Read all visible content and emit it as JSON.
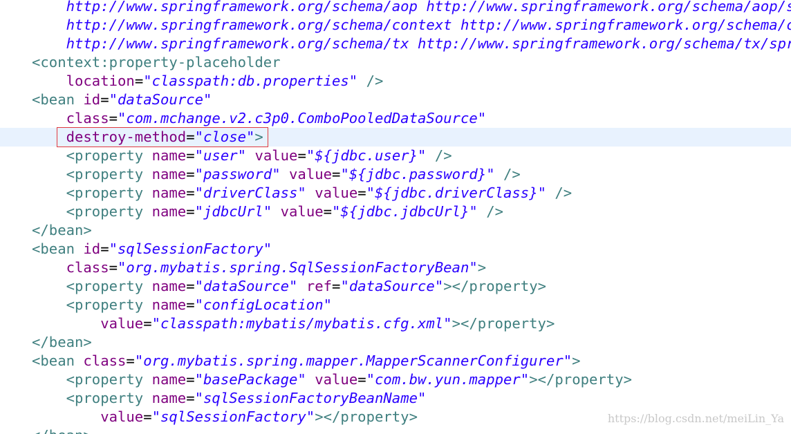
{
  "editor": {
    "lines": [
      {
        "tokens": [
          {
            "t": "    ",
            "c": "plain"
          },
          {
            "t": "http://www.springframework.org/schema/aop http://www.springframework.org/schema/aop/spring-aop.xsd",
            "c": "url"
          }
        ]
      },
      {
        "tokens": [
          {
            "t": "    ",
            "c": "plain"
          },
          {
            "t": "http://www.springframework.org/schema/context http://www.springframework.org/schema/context/spring-context.xsd",
            "c": "url"
          }
        ]
      },
      {
        "tokens": [
          {
            "t": "    ",
            "c": "plain"
          },
          {
            "t": "http://www.springframework.org/schema/tx http://www.springframework.org/schema/tx/spring-tx.xsd",
            "c": "url"
          }
        ]
      },
      {
        "tokens": [
          {
            "t": "<context:property-placeholder",
            "c": "tag"
          }
        ]
      },
      {
        "tokens": [
          {
            "t": "    ",
            "c": "plain"
          },
          {
            "t": "location",
            "c": "attr"
          },
          {
            "t": "=",
            "c": "eq"
          },
          {
            "t": "\"classpath:db.properties\"",
            "c": "val"
          },
          {
            "t": " />",
            "c": "tag"
          }
        ]
      },
      {
        "tokens": [
          {
            "t": "<bean",
            "c": "tag"
          },
          {
            "t": " ",
            "c": "plain"
          },
          {
            "t": "id",
            "c": "attr"
          },
          {
            "t": "=",
            "c": "eq"
          },
          {
            "t": "\"dataSource\"",
            "c": "val"
          }
        ]
      },
      {
        "tokens": [
          {
            "t": "    ",
            "c": "plain"
          },
          {
            "t": "class",
            "c": "attr"
          },
          {
            "t": "=",
            "c": "eq"
          },
          {
            "t": "\"com.mchange.v2.c3p0.ComboPooledDataSource\"",
            "c": "val"
          }
        ]
      },
      {
        "current": true,
        "tokens": [
          {
            "t": "    ",
            "c": "plain"
          },
          {
            "t": "destroy-method",
            "c": "attr"
          },
          {
            "t": "=",
            "c": "eq"
          },
          {
            "t": "\"close\"",
            "c": "val"
          },
          {
            "t": ">",
            "c": "tag"
          }
        ]
      },
      {
        "tokens": [
          {
            "t": "    ",
            "c": "plain"
          },
          {
            "t": "<property",
            "c": "tag"
          },
          {
            "t": " ",
            "c": "plain"
          },
          {
            "t": "name",
            "c": "attr"
          },
          {
            "t": "=",
            "c": "eq"
          },
          {
            "t": "\"user\"",
            "c": "val"
          },
          {
            "t": " ",
            "c": "plain"
          },
          {
            "t": "value",
            "c": "attr"
          },
          {
            "t": "=",
            "c": "eq"
          },
          {
            "t": "\"${jdbc.user}\"",
            "c": "val"
          },
          {
            "t": " />",
            "c": "tag"
          }
        ]
      },
      {
        "tokens": [
          {
            "t": "    ",
            "c": "plain"
          },
          {
            "t": "<property",
            "c": "tag"
          },
          {
            "t": " ",
            "c": "plain"
          },
          {
            "t": "name",
            "c": "attr"
          },
          {
            "t": "=",
            "c": "eq"
          },
          {
            "t": "\"password\"",
            "c": "val"
          },
          {
            "t": " ",
            "c": "plain"
          },
          {
            "t": "value",
            "c": "attr"
          },
          {
            "t": "=",
            "c": "eq"
          },
          {
            "t": "\"${jdbc.password}\"",
            "c": "val"
          },
          {
            "t": " />",
            "c": "tag"
          }
        ]
      },
      {
        "tokens": [
          {
            "t": "    ",
            "c": "plain"
          },
          {
            "t": "<property",
            "c": "tag"
          },
          {
            "t": " ",
            "c": "plain"
          },
          {
            "t": "name",
            "c": "attr"
          },
          {
            "t": "=",
            "c": "eq"
          },
          {
            "t": "\"driverClass\"",
            "c": "val"
          },
          {
            "t": " ",
            "c": "plain"
          },
          {
            "t": "value",
            "c": "attr"
          },
          {
            "t": "=",
            "c": "eq"
          },
          {
            "t": "\"${jdbc.driverClass}\"",
            "c": "val"
          },
          {
            "t": " />",
            "c": "tag"
          }
        ]
      },
      {
        "tokens": [
          {
            "t": "    ",
            "c": "plain"
          },
          {
            "t": "<property",
            "c": "tag"
          },
          {
            "t": " ",
            "c": "plain"
          },
          {
            "t": "name",
            "c": "attr"
          },
          {
            "t": "=",
            "c": "eq"
          },
          {
            "t": "\"jdbcUrl\"",
            "c": "val"
          },
          {
            "t": " ",
            "c": "plain"
          },
          {
            "t": "value",
            "c": "attr"
          },
          {
            "t": "=",
            "c": "eq"
          },
          {
            "t": "\"${jdbc.jdbcUrl}\"",
            "c": "val"
          },
          {
            "t": " />",
            "c": "tag"
          }
        ]
      },
      {
        "tokens": [
          {
            "t": "</bean>",
            "c": "tag"
          }
        ]
      },
      {
        "tokens": [
          {
            "t": "<bean",
            "c": "tag"
          },
          {
            "t": " ",
            "c": "plain"
          },
          {
            "t": "id",
            "c": "attr"
          },
          {
            "t": "=",
            "c": "eq"
          },
          {
            "t": "\"sqlSessionFactory\"",
            "c": "val"
          }
        ]
      },
      {
        "tokens": [
          {
            "t": "    ",
            "c": "plain"
          },
          {
            "t": "class",
            "c": "attr"
          },
          {
            "t": "=",
            "c": "eq"
          },
          {
            "t": "\"org.mybatis.spring.SqlSessionFactoryBean\"",
            "c": "val"
          },
          {
            "t": ">",
            "c": "tag"
          }
        ]
      },
      {
        "tokens": [
          {
            "t": "    ",
            "c": "plain"
          },
          {
            "t": "<property",
            "c": "tag"
          },
          {
            "t": " ",
            "c": "plain"
          },
          {
            "t": "name",
            "c": "attr"
          },
          {
            "t": "=",
            "c": "eq"
          },
          {
            "t": "\"dataSource\"",
            "c": "val"
          },
          {
            "t": " ",
            "c": "plain"
          },
          {
            "t": "ref",
            "c": "attr"
          },
          {
            "t": "=",
            "c": "eq"
          },
          {
            "t": "\"dataSource\"",
            "c": "val"
          },
          {
            "t": "></property>",
            "c": "tag"
          }
        ]
      },
      {
        "tokens": [
          {
            "t": "    ",
            "c": "plain"
          },
          {
            "t": "<property",
            "c": "tag"
          },
          {
            "t": " ",
            "c": "plain"
          },
          {
            "t": "name",
            "c": "attr"
          },
          {
            "t": "=",
            "c": "eq"
          },
          {
            "t": "\"configLocation\"",
            "c": "val"
          }
        ]
      },
      {
        "tokens": [
          {
            "t": "        ",
            "c": "plain"
          },
          {
            "t": "value",
            "c": "attr"
          },
          {
            "t": "=",
            "c": "eq"
          },
          {
            "t": "\"classpath:mybatis/mybatis.cfg.xml\"",
            "c": "val"
          },
          {
            "t": "></property>",
            "c": "tag"
          }
        ]
      },
      {
        "tokens": [
          {
            "t": "</bean>",
            "c": "tag"
          }
        ]
      },
      {
        "tokens": [
          {
            "t": "<bean",
            "c": "tag"
          },
          {
            "t": " ",
            "c": "plain"
          },
          {
            "t": "class",
            "c": "attr"
          },
          {
            "t": "=",
            "c": "eq"
          },
          {
            "t": "\"org.mybatis.spring.mapper.MapperScannerConfigurer\"",
            "c": "val"
          },
          {
            "t": ">",
            "c": "tag"
          }
        ]
      },
      {
        "tokens": [
          {
            "t": "    ",
            "c": "plain"
          },
          {
            "t": "<property",
            "c": "tag"
          },
          {
            "t": " ",
            "c": "plain"
          },
          {
            "t": "name",
            "c": "attr"
          },
          {
            "t": "=",
            "c": "eq"
          },
          {
            "t": "\"basePackage\"",
            "c": "val"
          },
          {
            "t": " ",
            "c": "plain"
          },
          {
            "t": "value",
            "c": "attr"
          },
          {
            "t": "=",
            "c": "eq"
          },
          {
            "t": "\"com.bw.yun.mapper\"",
            "c": "val"
          },
          {
            "t": "></property>",
            "c": "tag"
          }
        ]
      },
      {
        "tokens": [
          {
            "t": "    ",
            "c": "plain"
          },
          {
            "t": "<property",
            "c": "tag"
          },
          {
            "t": " ",
            "c": "plain"
          },
          {
            "t": "name",
            "c": "attr"
          },
          {
            "t": "=",
            "c": "eq"
          },
          {
            "t": "\"sqlSessionFactoryBeanName\"",
            "c": "val"
          }
        ]
      },
      {
        "tokens": [
          {
            "t": "        ",
            "c": "plain"
          },
          {
            "t": "value",
            "c": "attr"
          },
          {
            "t": "=",
            "c": "eq"
          },
          {
            "t": "\"sqlSessionFactory\"",
            "c": "val"
          },
          {
            "t": "></property>",
            "c": "tag"
          }
        ]
      },
      {
        "tokens": [
          {
            "t": "</bean>",
            "c": "tag"
          }
        ]
      }
    ]
  },
  "watermark": "https://blog.csdn.net/meiLin_Ya",
  "colors": {
    "tag": "#3f7f7f",
    "attribute": "#7f007f",
    "string_value": "#2a00ff",
    "current_line_highlight": "#e8f2fe",
    "annotation_box": "#e0393e"
  }
}
